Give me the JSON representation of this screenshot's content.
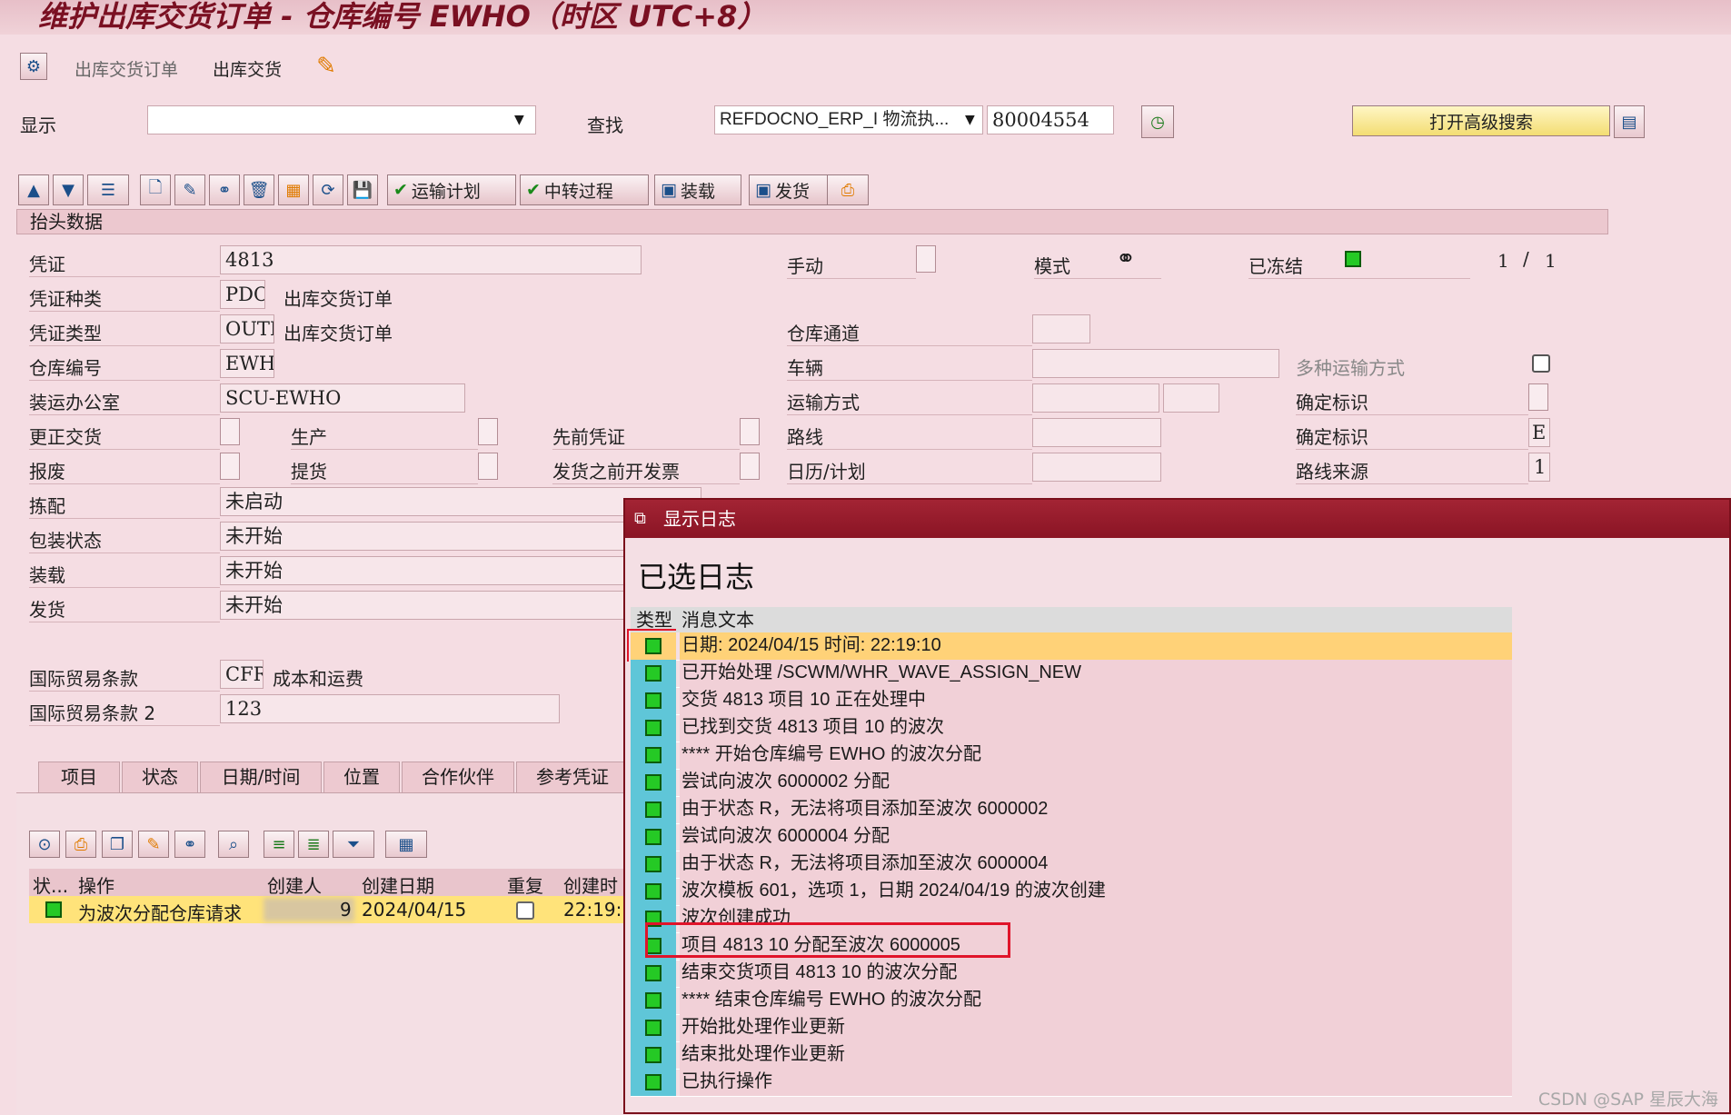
{
  "window": {
    "title": "维护出库交货订单 - 仓库编号 EWHO（时区 UTC+8）"
  },
  "menu": {
    "items": [
      "出库交货订单",
      "出库交货"
    ]
  },
  "top": {
    "display_label": "显示",
    "display_value": "",
    "search_label": "查找",
    "search_field_select": "REFDOCNO_ERP_I 物流执...",
    "search_value": "80004554",
    "advanced_search": "打开高级搜索"
  },
  "toolbar": {
    "transport_plan": "运输计划",
    "transfer_process": "中转过程",
    "loading": "装载",
    "shipping": "发货"
  },
  "header": {
    "section_title": "抬头数据",
    "doc_label": "凭证",
    "doc_value": "4813",
    "doc_cat_label": "凭证种类",
    "doc_cat_code": "PDO",
    "doc_cat_text": "出库交货订单",
    "doc_type_label": "凭证类型",
    "doc_type_code": "OUTB",
    "doc_type_text": "出库交货订单",
    "wh_label": "仓库编号",
    "wh_value": "EWHO",
    "ship_office_label": "装运办公室",
    "ship_office_value": "SCU-EWHO",
    "correction_label": "更正交货",
    "production_label": "生产",
    "prev_doc_label": "先前凭证",
    "scrap_label": "报废",
    "pickup_label": "提货",
    "invoice_label": "发货之前开发票",
    "pick_label": "拣配",
    "pick_value": "未启动",
    "pack_label": "包装状态",
    "pack_value": "未开始",
    "load_label": "装载",
    "load_value": "未开始",
    "ship_label": "发货",
    "ship_value": "未开始",
    "incoterms_label": "国际贸易条款",
    "incoterms_code": "CFR",
    "incoterms_text": "成本和运费",
    "incoterms2_label": "国际贸易条款 2",
    "incoterms2_value": "123",
    "manual_label": "手动",
    "mode_label": "模式",
    "frozen_label": "已冻结",
    "page_current": "1",
    "page_sep": "/",
    "page_total": "1",
    "wh_door_label": "仓库通道",
    "vehicle_label": "车辆",
    "multi_transport_label": "多种运输方式",
    "transport_mode_label": "运输方式",
    "confirm_id_label": "确定标识",
    "route_label": "路线",
    "confirm_id2_label": "确定标识",
    "confirm_id2_value": "E",
    "calendar_label": "日历/计划",
    "route_source_label": "路线来源",
    "route_source_value": "1"
  },
  "tabs": [
    "项目",
    "状态",
    "日期/时间",
    "位置",
    "合作伙伴",
    "参考凭证"
  ],
  "grid": {
    "columns": [
      "状...",
      "操作",
      "创建人",
      "创建日期",
      "重复",
      "创建时"
    ],
    "row": {
      "action": "为波次分配仓库请求",
      "creator_tail": "9",
      "date": "2024/04/15",
      "time": "22:19:1"
    }
  },
  "popup": {
    "title": "显示日志",
    "heading": "已选日志",
    "col_type": "类型",
    "col_msg": "消息文本",
    "rows": [
      "日期: 2024/04/15        时间: 22:19:10",
      "已开始处理 /SCWM/WHR_WAVE_ASSIGN_NEW",
      "交货 4813 项目 10 正在处理中",
      "已找到交货 4813 项目 10 的波次",
      "**** 开始仓库编号 EWHO 的波次分配",
      "尝试向波次 6000002 分配",
      "由于状态 R，无法将项目添加至波次 6000002",
      "尝试向波次 6000004 分配",
      "由于状态 R，无法将项目添加至波次 6000004",
      "波次模板 601，选项 1，日期 2024/04/19 的波次创建",
      "波次创建成功",
      "项目 4813 10  分配至波次 6000005",
      "结束交货项目 4813 10  的波次分配",
      "**** 结束仓库编号 EWHO 的波次分配",
      "开始批处理作业更新",
      "结束批处理作业更新",
      "已执行操作"
    ]
  },
  "watermark": "CSDN @SAP 星辰大海",
  "colors": {
    "status_green": "#25c925",
    "highlight_red": "#e0142a",
    "popup_title": "#8a1424"
  }
}
